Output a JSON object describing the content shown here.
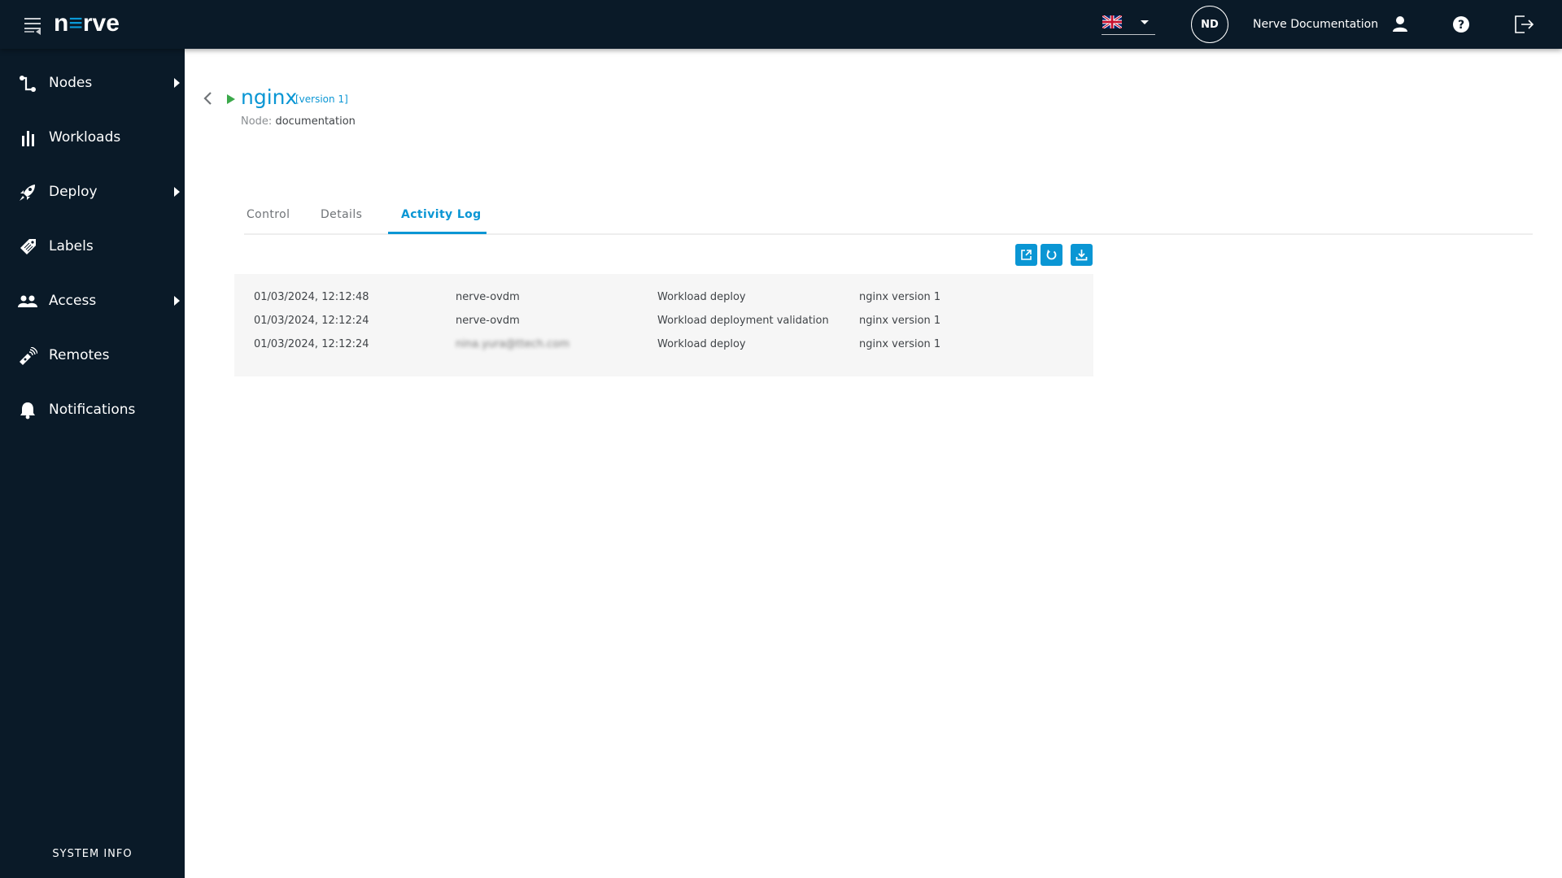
{
  "topbar": {
    "logo_left": "n",
    "logo_e": "≡",
    "logo_right": "rve",
    "menu_icon": "menu-collapse-icon",
    "language": {
      "selected": "English",
      "flag_icon": "uk-flag-icon"
    },
    "avatar_initials": "ND",
    "user_name": "Nerve Documentation",
    "icons": [
      "user-icon",
      "help-icon",
      "logout-icon"
    ]
  },
  "sidebar": {
    "items": [
      {
        "label": "Nodes",
        "icon": "nodes-icon",
        "has_submenu": true
      },
      {
        "label": "Workloads",
        "icon": "workloads-icon",
        "has_submenu": false
      },
      {
        "label": "Deploy",
        "icon": "rocket-icon",
        "has_submenu": true
      },
      {
        "label": "Labels",
        "icon": "tag-icon",
        "has_submenu": false
      },
      {
        "label": "Access",
        "icon": "users-icon",
        "has_submenu": true
      },
      {
        "label": "Remotes",
        "icon": "remote-icon",
        "has_submenu": false
      },
      {
        "label": "Notifications",
        "icon": "bell-icon",
        "has_submenu": false
      }
    ],
    "system_info": "SYSTEM INFO"
  },
  "workload": {
    "name": "nginx",
    "version": "[version 1]",
    "status": "running",
    "node_label": "Node:",
    "node_value": "documentation"
  },
  "tabs": [
    {
      "label": "Control",
      "active": false
    },
    {
      "label": "Details",
      "active": false
    },
    {
      "label": "Activity Log",
      "active": true
    }
  ],
  "activity_log": {
    "actions": [
      "open-external-icon",
      "refresh-icon",
      "download-icon"
    ],
    "rows": [
      {
        "timestamp": "01/03/2024, 12:12:48",
        "user": "nerve-ovdm",
        "action": "Workload deploy",
        "target": "nginx version 1",
        "user_blurred": false
      },
      {
        "timestamp": "01/03/2024, 12:12:24",
        "user": "nerve-ovdm",
        "action": "Workload deployment validation",
        "target": "nginx version 1",
        "user_blurred": false
      },
      {
        "timestamp": "01/03/2024, 12:12:24",
        "user": "nina.yura@ttech.com",
        "action": "Workload deploy",
        "target": "nginx version 1",
        "user_blurred": true
      }
    ]
  },
  "colors": {
    "brand_dark": "#0a1a28",
    "accent": "#0a96d4",
    "running": "#3ba94a"
  }
}
